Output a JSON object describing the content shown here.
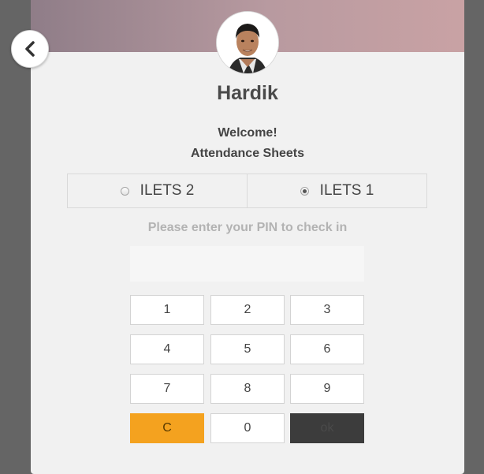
{
  "user": {
    "name": "Hardik"
  },
  "welcome": {
    "line1": "Welcome!",
    "line2": "Attendance Sheets"
  },
  "options": [
    {
      "label": "ILETS 2",
      "checked": false
    },
    {
      "label": "ILETS 1",
      "checked": true
    }
  ],
  "prompt": "Please enter your PIN to check in",
  "pin": {
    "value": "",
    "placeholder": ""
  },
  "keypad": {
    "k1": "1",
    "k2": "2",
    "k3": "3",
    "k4": "4",
    "k5": "5",
    "k6": "6",
    "k7": "7",
    "k8": "8",
    "k9": "9",
    "clear": "C",
    "k0": "0",
    "ok": "ok"
  },
  "colors": {
    "header_gradient": [
      "#8f7d88",
      "#c9a2a4"
    ],
    "clear_key": "#f4a21f",
    "ok_key": "#3c3c3c",
    "backdrop": "#656565"
  },
  "icons": {
    "back": "chevron-left-icon"
  }
}
